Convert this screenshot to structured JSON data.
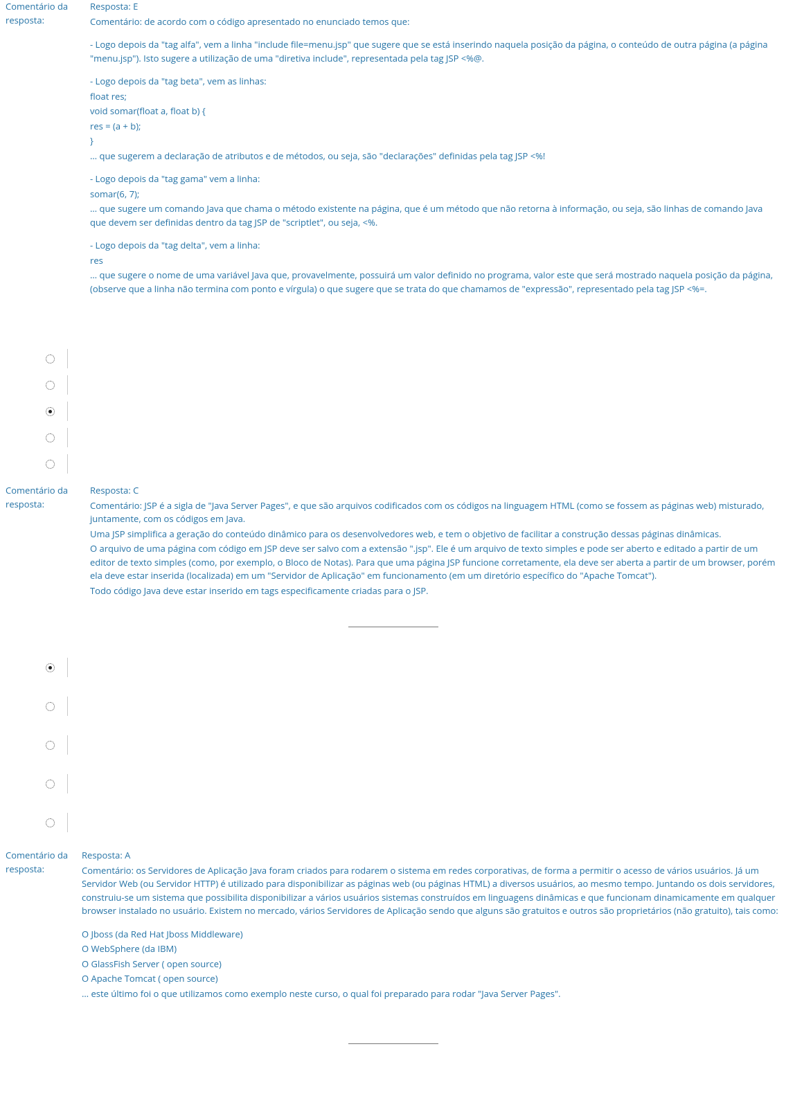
{
  "q1": {
    "label": "Comentário da resposta:",
    "resp": "Resposta: E",
    "intro": "Comentário: de acordo com o código apresentado no enunciado temos que:",
    "p_alfa": "- Logo depois da \"tag alfa\", vem a linha \"include file=menu.jsp\" que sugere que se está inserindo naquela posição da página, o conteúdo de outra página (a página \"menu.jsp\"). Isto sugere a utilização de uma \"diretiva include\", representada pela tag JSP <%@.",
    "p_beta_head": "- Logo depois da \"tag beta\", vem as linhas:",
    "p_beta_l1": "float res;",
    "p_beta_l2": "void somar(float a, float b) {",
    "p_beta_l3": "res = (a + b);",
    "p_beta_l4": "}",
    "p_beta_tail": "… que sugerem a declaração de atributos e de métodos, ou seja, são \"declarações\" definidas pela tag JSP <%!",
    "p_gama_head": "- Logo depois da \"tag gama\" vem a linha:",
    "p_gama_l1": "somar(6, 7);",
    "p_gama_tail": "… que sugere um comando Java que chama o método existente na página, que é um método que não retorna à informação, ou seja, são linhas de comando Java que devem ser definidas dentro da tag JSP de \"scriptlet\", ou seja, <%.",
    "p_delta_head": "- Logo depois da \"tag delta\", vem a linha:",
    "p_delta_l1": "res",
    "p_delta_tail": "… que sugere o nome de uma variável Java que, provavelmente, possuirá um valor definido no programa, valor este que será mostrado naquela posição da página, (observe que a linha não termina com ponto e vírgula) o que sugere que se trata do que chamamos de \"expressão\", representado pela tag JSP <%=."
  },
  "q2": {
    "selected_index": 2,
    "options_count": 5,
    "label": "Comentário da resposta:",
    "resp": "Resposta: C",
    "p1": "Comentário: JSP é a sigla de \"Java Server Pages\", e que são arquivos codificados com os códigos na linguagem HTML (como se fossem as páginas web) misturado, juntamente, com os códigos em Java.",
    "p2": "Uma JSP simplifica a geração do conteúdo dinâmico para os desenvolvedores web, e tem o objetivo de facilitar a construção dessas páginas dinâmicas.",
    "p3": "O arquivo de uma página com código em JSP deve ser salvo com a extensão \".jsp\". Ele é um arquivo de texto simples e pode ser aberto e editado a partir de um editor de texto simples (como, por exemplo, o Bloco de Notas). Para que uma página JSP funcione corretamente, ela deve ser aberta a partir de um browser, porém ela deve estar inserida (localizada) em um \"Servidor de Aplicação\" em funcionamento (em um diretório específico do \"Apache Tomcat\").",
    "p4": "Todo código Java deve estar inserido em tags especificamente criadas para o JSP."
  },
  "q3": {
    "selected_index": 0,
    "options_count": 5,
    "label": "Comentário da resposta:",
    "resp": "Resposta: A",
    "p1": "Comentário: os Servidores de Aplicação Java foram criados para rodarem o sistema em redes corporativas, de forma a permitir o acesso de vários usuários. Já um Servidor Web (ou Servidor HTTP) é utilizado para disponibilizar as páginas web (ou páginas HTML) a diversos usuários, ao mesmo tempo. Juntando os dois servidores, construiu-se um sistema que possibilita disponibilizar a vários usuários sistemas construídos em linguagens dinâmicas e que funcionam dinamicamente em qualquer browser instalado no usuário. Existem no mercado, vários Servidores de Aplicação sendo que alguns são gratuitos e outros são proprietários (não gratuito), tais como:",
    "li1": "O Jboss (da Red Hat Jboss Middleware)",
    "li2": "O WebSphere (da IBM)",
    "li3": "O GlassFish Server ( open source)",
    "li4": "O Apache Tomcat ( open source)",
    "tail": "… este último foi o que utilizamos como exemplo neste curso, o qual foi preparado para rodar \"Java Server Pages\"."
  }
}
